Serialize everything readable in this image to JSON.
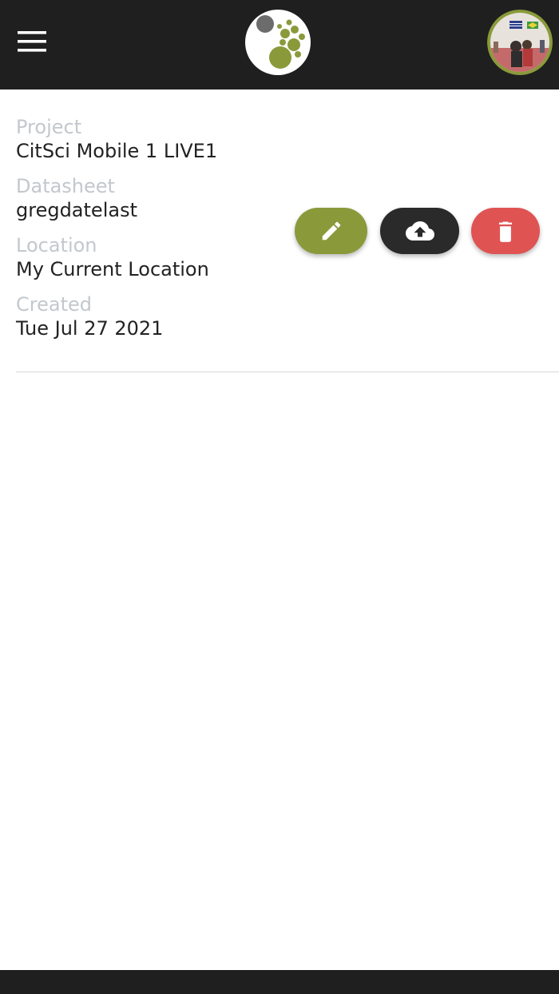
{
  "colors": {
    "topbar": "#1f1f1f",
    "edit": "#8a9a3b",
    "upload": "#2a2a2a",
    "delete": "#e05353",
    "label": "#c3c8cd",
    "value": "#222222"
  },
  "header": {
    "menu_icon": "hamburger-icon",
    "logo_icon": "citsci-logo",
    "avatar": "user-avatar"
  },
  "record": {
    "fields": [
      {
        "label": "Project",
        "value": "CitSci Mobile 1 LIVE1"
      },
      {
        "label": "Datasheet",
        "value": "gregdatelast"
      },
      {
        "label": "Location",
        "value": "My Current Location"
      },
      {
        "label": "Created",
        "value": "Tue Jul 27 2021"
      }
    ],
    "actions": {
      "edit_icon": "pencil-icon",
      "upload_icon": "cloud-upload-icon",
      "delete_icon": "trash-icon"
    }
  }
}
